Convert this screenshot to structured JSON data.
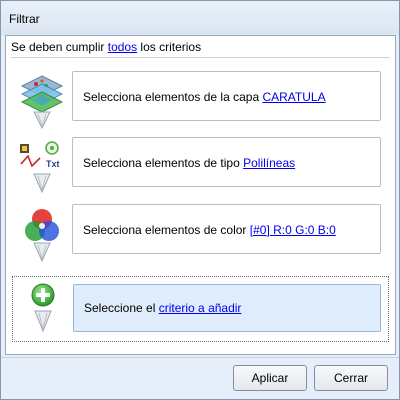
{
  "window": {
    "title": "Filtrar"
  },
  "header": {
    "prefix": "Se deben cumplir ",
    "link": "todos",
    "suffix": " los criterios"
  },
  "criteria": [
    {
      "prefix": "Selecciona elementos de la capa ",
      "link": "CARATULA",
      "icon": "layers-icon"
    },
    {
      "prefix": "Selecciona elementos de tipo ",
      "link": "Polilíneas",
      "icon": "geometry-type-icon"
    },
    {
      "prefix": "Selecciona elementos de color ",
      "link": "[#0] R:0 G:0 B:0",
      "icon": "color-rgb-icon"
    },
    {
      "prefix": "Seleccione el ",
      "link": "criterio a añadir",
      "icon": "add-criterion-icon"
    }
  ],
  "buttons": {
    "apply": "Aplicar",
    "close": "Cerrar"
  },
  "colors": {
    "link": "#0000ee",
    "selected_bg": "#dfecfb",
    "window_bg": "#e5eef9",
    "add_green": "#39a935"
  }
}
